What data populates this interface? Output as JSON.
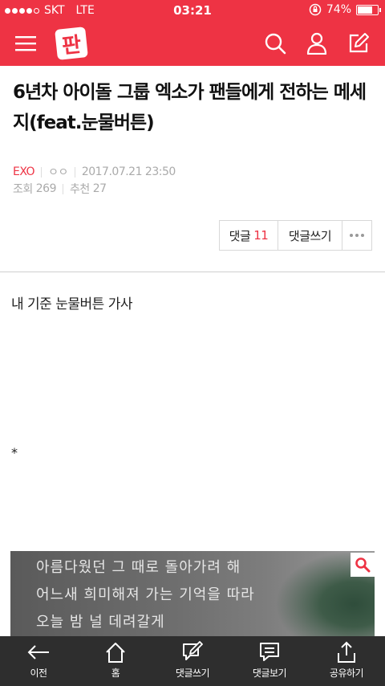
{
  "status_bar": {
    "carrier": "SKT",
    "network": "LTE",
    "time": "03:21",
    "battery": "74%",
    "battery_level": 0.74
  },
  "nav": {
    "logo_text": "판",
    "icons": [
      "menu-icon",
      "search-icon",
      "user-icon",
      "edit-icon"
    ]
  },
  "article": {
    "title": "6년차 아이돌 그룹 엑소가 팬들에게 전하는 메세지(feat.눈물버튼)",
    "category": "EXO",
    "author": "ㅇㅇ",
    "date": "2017.07.21 23:50",
    "views_label": "조회",
    "views": "269",
    "recommend_label": "추천",
    "recommend": "27",
    "comment_label": "댓글",
    "comment_count": "11",
    "write_comment": "댓글쓰기",
    "body_line": "내 기준 눈물버튼 가사",
    "asterisk": "*"
  },
  "lyrics_image": {
    "lines": [
      "아름다웠던 그 때로 돌아가려 해",
      "어느새 희미해져 가는 기억을 따라",
      "오늘 밤 널 데려갈게"
    ]
  },
  "toolbar": {
    "items": [
      {
        "label": "이전",
        "icon": "back-arrow-icon"
      },
      {
        "label": "홈",
        "icon": "home-icon"
      },
      {
        "label": "댓글쓰기",
        "icon": "write-comment-icon"
      },
      {
        "label": "댓글보기",
        "icon": "view-comments-icon"
      },
      {
        "label": "공유하기",
        "icon": "share-icon"
      }
    ]
  },
  "colors": {
    "brand": "#ee3344",
    "toolbar_bg": "#2e2e2e"
  }
}
